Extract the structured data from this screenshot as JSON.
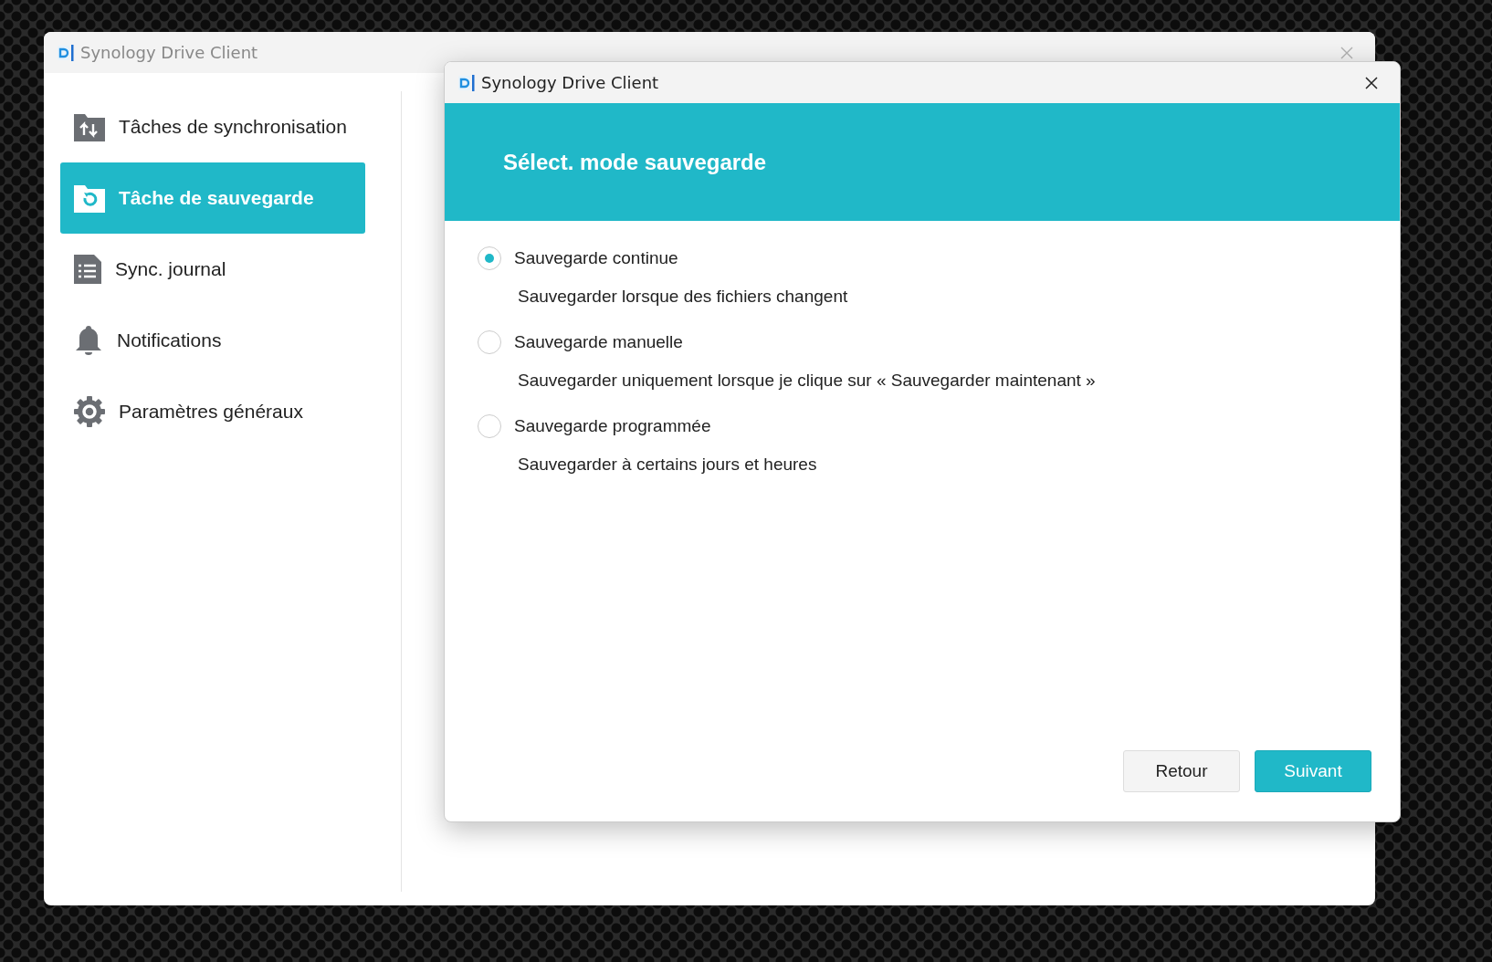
{
  "main_window": {
    "title": "Synology Drive Client"
  },
  "sidebar": {
    "items": [
      {
        "label": "Tâches de synchronisation",
        "selected": false
      },
      {
        "label": "Tâche de sauvegarde",
        "selected": true
      },
      {
        "label": "Sync. journal",
        "selected": false
      },
      {
        "label": "Notifications",
        "selected": false
      },
      {
        "label": "Paramètres généraux",
        "selected": false
      }
    ]
  },
  "dialog": {
    "title": "Synology Drive Client",
    "heading": "Sélect. mode sauvegarde",
    "options": [
      {
        "label": "Sauvegarde continue",
        "description": "Sauvegarder lorsque des fichiers changent",
        "selected": true
      },
      {
        "label": "Sauvegarde manuelle",
        "description": "Sauvegarder uniquement lorsque je clique sur « Sauvegarder maintenant »",
        "selected": false
      },
      {
        "label": "Sauvegarde programmée",
        "description": "Sauvegarder à certains jours et heures",
        "selected": false
      }
    ],
    "buttons": [
      {
        "label": "Retour",
        "kind": "secondary"
      },
      {
        "label": "Suivant",
        "kind": "primary"
      }
    ]
  }
}
